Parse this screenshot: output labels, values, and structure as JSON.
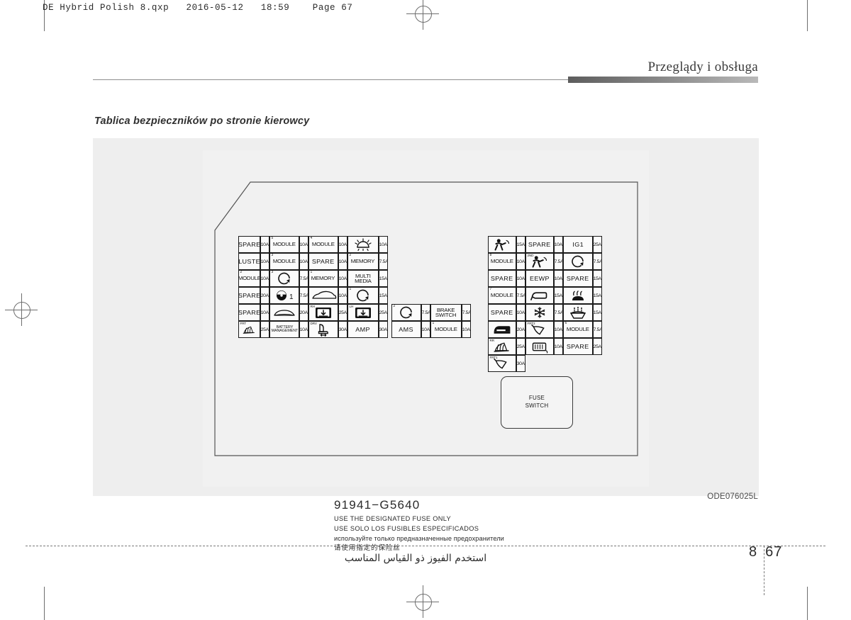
{
  "print": {
    "slug": "DE Hybrid Polish 8.qxp   2016-05-12   18:59    Page 67"
  },
  "header": {
    "running_head": "Przeglądy i obsługa"
  },
  "section": {
    "title": "Tablica bezpieczników po stronie kierowcy"
  },
  "figure": {
    "code": "ODE076025L",
    "fuse_switch_line1": "FUSE",
    "fuse_switch_line2": "SWITCH",
    "part_number": "91941−G5640",
    "warnings": {
      "en": "USE THE DESIGNATED FUSE ONLY",
      "es": "USE SOLO LOS FUSIBLES ESPECIFICADOS",
      "ru": "используйте только предназначенные предохранители",
      "zh": "请使用指定的保险丝",
      "ar": "استخدم الفيوز ذو القياس المناسب"
    },
    "left_block": {
      "rows": [
        [
          {
            "label": "SPARE",
            "amp": "10A"
          },
          {
            "label": "MODULE",
            "sup": "5",
            "amp": "10A"
          },
          {
            "label": "MODULE",
            "sup": "4",
            "amp": "10A"
          },
          {
            "icon": "headlamp-icon",
            "amp": "10A"
          }
        ],
        [
          {
            "label": "CLUSTER",
            "amp": "10A"
          },
          {
            "label": "MODULE",
            "sup": "3",
            "amp": "10A"
          },
          {
            "label": "SPARE",
            "amp": "10A"
          },
          {
            "label": "MEMORY",
            "sup": "2",
            "amp": "7.5A"
          }
        ],
        [
          {
            "label": "MODULE",
            "sup": "2",
            "amp": "10A"
          },
          {
            "icon": "circle-arrow-icon",
            "sup": "3",
            "amp": "7.5A"
          },
          {
            "label": "MEMORY",
            "sup": "1",
            "amp": "10A"
          },
          {
            "label": "MULTI\nMEDIA",
            "amp": "15A"
          }
        ],
        [
          {
            "label": "SPARE",
            "amp": "20A"
          },
          {
            "icon": "steering-wheel-1-icon",
            "amp": "7.5A"
          },
          {
            "icon": "car-side-icon",
            "amp": "10A"
          },
          {
            "icon": "circle-arrow-icon",
            "sup": "1",
            "amp": "15A"
          }
        ],
        [
          {
            "label": "SPARE",
            "amp": "10A"
          },
          {
            "icon": "car-hood-icon",
            "amp": "20A"
          },
          {
            "icon": "window-lift-icon",
            "pre": "RH",
            "amp": "25A"
          },
          {
            "icon": "window-lift-icon",
            "pre": "LH",
            "amp": "25A"
          }
        ],
        [
          {
            "icon": "heated-seat-icon",
            "pre": "FRT",
            "amp": "25A"
          },
          {
            "label": "BATTERY\nMANAGEMENT",
            "amp": "10A"
          },
          {
            "icon": "power-seat-icon",
            "pre": "DRV",
            "amp": "30A"
          },
          {
            "label": "AMP",
            "amp": "30A"
          }
        ]
      ]
    },
    "center_block": {
      "rows": [
        [
          {
            "icon": "circle-arrow-icon",
            "sup": "2",
            "amp": "7.5A"
          },
          {
            "label": "BRAKE\nSWITCH",
            "amp": "7.5A"
          }
        ],
        [
          {
            "label": "AMS",
            "amp": "10A"
          },
          {
            "label": "MODULE",
            "sup": "1",
            "amp": "10A"
          }
        ]
      ]
    },
    "right_block": {
      "rows": [
        [
          {
            "icon": "airbag-icon",
            "amp": "15A"
          },
          {
            "label": "SPARE",
            "amp": "10A"
          },
          {
            "label": "IG1",
            "amp": "25A"
          }
        ],
        [
          {
            "label": "MODULE",
            "sup": "8",
            "amp": "10A"
          },
          {
            "icon": "airbag-icon",
            "pre": "2ND",
            "amp": "7.5A"
          },
          {
            "icon": "circle-arrow-icon",
            "amp": "7.5A"
          }
        ],
        [
          {
            "label": "SPARE",
            "amp": "10A"
          },
          {
            "label": "EEWP",
            "amp": "10A"
          },
          {
            "label": "SPARE",
            "amp": "15A"
          }
        ],
        [
          {
            "label": "MODULE",
            "sup": "7",
            "amp": "7.5A"
          },
          {
            "icon": "mirror-icon",
            "amp": "15A"
          },
          {
            "icon": "heated-steering-icon",
            "amp": "15A"
          }
        ],
        [
          {
            "label": "SPARE",
            "amp": "10A"
          },
          {
            "icon": "ac-snowflake-icon",
            "amp": "7.5A"
          },
          {
            "icon": "washer-icon",
            "amp": "15A"
          }
        ],
        [
          {
            "icon": "sunroof-icon",
            "amp": "20A"
          },
          {
            "icon": "wiper-icon",
            "pre": "FRT2",
            "amp": "10A"
          },
          {
            "label": "MODULE",
            "sup": "6",
            "amp": "7.5A"
          }
        ],
        [
          {
            "icon": "heated-seat-icon",
            "pre": "RR",
            "amp": "25A"
          },
          {
            "icon": "rear-defog-icon",
            "amp": "10A"
          },
          {
            "label": "SPARE",
            "amp": "25A"
          },
          {
            "icon": "wiper-icon",
            "pre": "FRT1",
            "amp": "30A"
          }
        ]
      ]
    }
  },
  "footer": {
    "chapter": "8",
    "page": "67"
  }
}
